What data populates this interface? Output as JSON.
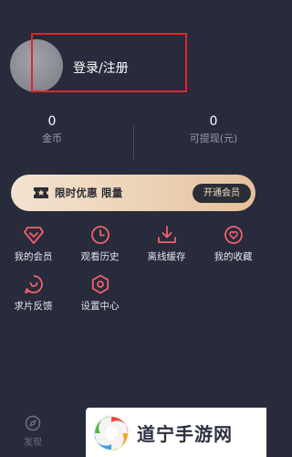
{
  "profile": {
    "login_label": "登录/注册"
  },
  "stats": {
    "coins": {
      "value": "0",
      "label": "金币"
    },
    "withdrawable": {
      "value": "0",
      "label": "可提现(元)"
    }
  },
  "vip_banner": {
    "text": "限时优惠 限量",
    "button": "开通会员"
  },
  "menu": {
    "items": [
      {
        "label": "我的会员",
        "icon": "diamond-icon"
      },
      {
        "label": "观看历史",
        "icon": "clock-icon"
      },
      {
        "label": "离线缓存",
        "icon": "download-icon"
      },
      {
        "label": "我的收藏",
        "icon": "heart-icon"
      },
      {
        "label": "求片反馈",
        "icon": "feedback-icon"
      },
      {
        "label": "设置中心",
        "icon": "settings-icon"
      }
    ]
  },
  "bottom_nav": {
    "discover": "发现"
  },
  "watermark": {
    "text": "道宁手游网"
  },
  "colors": {
    "background": "#272b3b",
    "accent_red": "#f0616d",
    "vip_gold": "#ecd3b6",
    "highlight_red": "#e0242b"
  }
}
